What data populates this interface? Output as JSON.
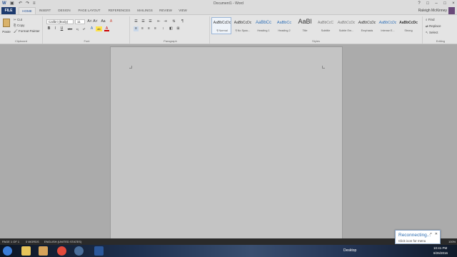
{
  "titlebar": {
    "title": "Document1 - Word",
    "quick_access": {
      "word_icon": "W",
      "save_icon": "▣",
      "undo_icon": "↶",
      "redo_icon": "↷",
      "customize_icon": "≡"
    },
    "help": "?",
    "ribbon_display": "□",
    "minimize": "–",
    "maximize": "□",
    "close": "×"
  },
  "tabs": {
    "file": "FILE",
    "items": [
      "HOME",
      "INSERT",
      "DESIGN",
      "PAGE LAYOUT",
      "REFERENCES",
      "MAILINGS",
      "REVIEW",
      "VIEW"
    ],
    "user": "Raleigh McKinney"
  },
  "ribbon": {
    "clipboard": {
      "label": "Clipboard",
      "paste": "Paste",
      "cut": "Cut",
      "copy": "Copy",
      "format_painter": "Format Painter"
    },
    "font": {
      "label": "Font",
      "font_name": "Calibri (Body)",
      "font_size": "11",
      "bold": "B",
      "italic": "I",
      "underline": "U",
      "strike": "abc",
      "subscript": "x₂",
      "superscript": "x²",
      "grow": "A˄",
      "shrink": "A˅",
      "case": "Aa",
      "clear": "A",
      "color": "A",
      "highlight": "ab"
    },
    "paragraph": {
      "label": "Paragraph",
      "show_marks": "¶",
      "sort": "⇅"
    },
    "styles": {
      "label": "Styles",
      "items": [
        {
          "preview": "AaBbCcDc",
          "name": "¶ Normal"
        },
        {
          "preview": "AaBbCcDc",
          "name": "¶ No Spac..."
        },
        {
          "preview": "AaBbCc",
          "name": "Heading 1"
        },
        {
          "preview": "AaBbCc",
          "name": "Heading 2"
        },
        {
          "preview": "AaBl",
          "name": "Title"
        },
        {
          "preview": "AaBbCcC",
          "name": "Subtitle"
        },
        {
          "preview": "AaBbCcDc",
          "name": "Subtle Em..."
        },
        {
          "preview": "AaBbCcDc",
          "name": "Emphasis"
        },
        {
          "preview": "AaBbCcDc",
          "name": "Intense E..."
        },
        {
          "preview": "AaBbCcDc",
          "name": "Strong"
        }
      ]
    },
    "editing": {
      "label": "Editing",
      "find": "Find",
      "replace": "Replace",
      "select": "Select"
    }
  },
  "statusbar": {
    "page": "PAGE 1 OF 1",
    "words": "0 WORDS",
    "language": "ENGLISH (UNITED STATES)",
    "zoom": "100%"
  },
  "taskbar": {
    "desktop": "Desktop",
    "time": "10:41 PM",
    "date": "8/26/2016"
  },
  "notification": {
    "title": "Reconnecting...",
    "subtitle": "Click icon for menu"
  },
  "colors": {
    "file_tab": "#1c3a6e",
    "accent": "#2b579a",
    "popup_title": "#2b6cb0"
  }
}
